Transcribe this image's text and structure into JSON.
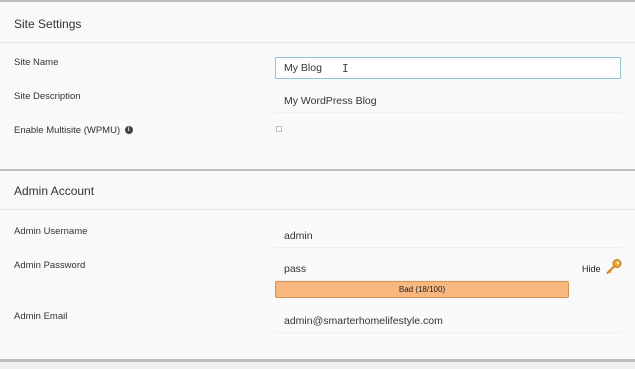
{
  "site_settings": {
    "title": "Site Settings",
    "site_name": {
      "label": "Site Name",
      "value": "My Blog"
    },
    "site_description": {
      "label": "Site Description",
      "value": "My WordPress Blog"
    },
    "multisite": {
      "label": "Enable Multisite (WPMU)",
      "info_icon": "info-icon",
      "checked": false
    }
  },
  "admin_account": {
    "title": "Admin Account",
    "username": {
      "label": "Admin Username",
      "value": "admin"
    },
    "password": {
      "label": "Admin Password",
      "value": "pass",
      "toggle_label": "Hide",
      "generate_icon": "key-icon",
      "strength_text": "Bad (18/100)",
      "strength_color": "#f8b77e"
    },
    "email": {
      "label": "Admin Email",
      "value": "admin@smarterhomelifestyle.com"
    }
  },
  "colors": {
    "background": "#f9f9f9",
    "active_border": "#8fc6d6",
    "section_border": "#bdbdbd"
  }
}
